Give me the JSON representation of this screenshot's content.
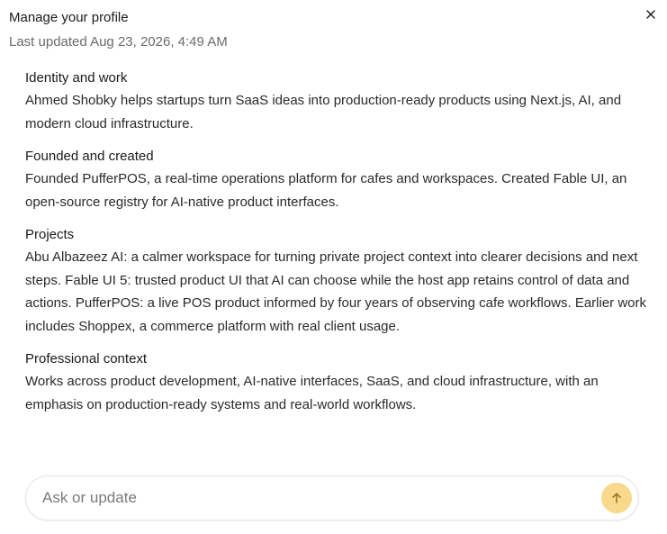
{
  "header": {
    "title": "Manage your profile",
    "updated": "Last updated Aug 23, 2026, 4:49 AM",
    "close_icon": "close-icon"
  },
  "sections": [
    {
      "heading": "Identity and work",
      "body": "Ahmed Shobky helps startups turn SaaS ideas into production-ready products using Next.js, AI, and modern cloud infrastructure."
    },
    {
      "heading": "Founded and created",
      "body": "Founded PufferPOS, a real-time operations platform for cafes and workspaces. Created Fable UI, an open-source registry for AI-native product interfaces."
    },
    {
      "heading": "Projects",
      "body": "Abu Albazeez AI: a calmer workspace for turning private project context into clearer decisions and next steps. Fable UI 5: trusted product UI that AI can choose while the host app retains control of data and actions. PufferPOS: a live POS product informed by four years of observing cafe workflows. Earlier work includes Shoppex, a commerce platform with real client usage."
    },
    {
      "heading": "Professional context",
      "body": "Works across product development, AI-native interfaces, SaaS, and cloud infrastructure, with an emphasis on production-ready systems and real-world workflows."
    }
  ],
  "composer": {
    "value": "",
    "placeholder": "Ask or update",
    "send_icon": "arrow-up-icon",
    "send_color": "#f9d98c"
  }
}
